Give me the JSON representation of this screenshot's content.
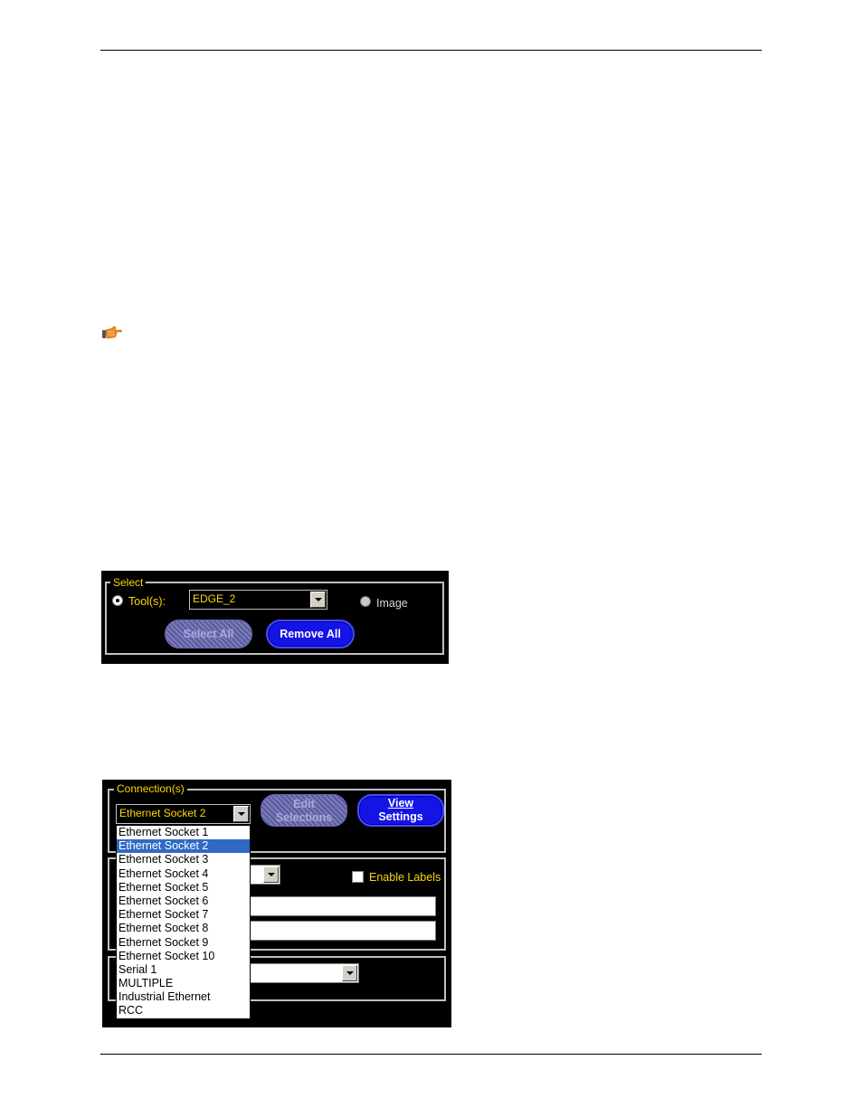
{
  "select_panel": {
    "group_title": "Select",
    "tools_label": "Tool(s):",
    "tool_combo_value": "EDGE_2",
    "image_label": "Image",
    "select_all_label": "Select All",
    "remove_all_label": "Remove All"
  },
  "connection_panel": {
    "group_title": "Connection(s)",
    "connection_combo_value": "Ethernet Socket 2",
    "edit_selections_line1": "Edit",
    "edit_selections_line2": "Selections",
    "view_settings_line1": "View",
    "view_settings_line2": "Settings",
    "enable_labels_label": "Enable Labels",
    "dropdown_options": [
      "Ethernet Socket 1",
      "Ethernet Socket 2",
      "Ethernet Socket 3",
      "Ethernet Socket 4",
      "Ethernet Socket 5",
      "Ethernet Socket 6",
      "Ethernet Socket 7",
      "Ethernet Socket 8",
      "Ethernet Socket 9",
      "Ethernet Socket 10",
      "Serial 1",
      "MULTIPLE",
      "Industrial Ethernet",
      "RCC"
    ],
    "selected_index": 1
  },
  "icons": {
    "note": "pointing-hand-icon"
  },
  "colors": {
    "panel_bg": "#000000",
    "label_yellow": "#ffd700",
    "button_blue": "#1414e6",
    "selection_blue": "#316ac5"
  }
}
